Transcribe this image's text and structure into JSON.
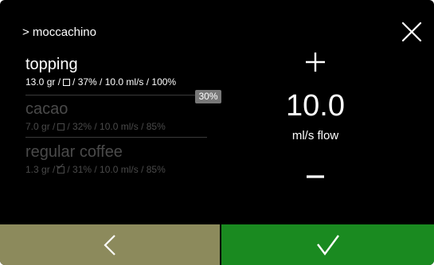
{
  "header": {
    "breadcrumb": "> moccachino"
  },
  "icons": {
    "close": "close-icon",
    "plus": "plus-icon",
    "minus": "minus-icon",
    "back": "chevron-left-icon",
    "confirm": "checkmark-icon"
  },
  "ingredients": [
    {
      "name": "topping",
      "amount": "13.0 gr /",
      "checkbox": false,
      "rest": "/ 37% / 10.0 ml/s / 100%",
      "state": "selected"
    },
    {
      "name": "cacao",
      "amount": "7.0 gr /",
      "checkbox": false,
      "rest": "/ 32% / 10.0 ml/s / 85%",
      "state": "inactive"
    },
    {
      "name": "regular coffee",
      "amount": "1.3 gr /",
      "checkbox": true,
      "rest": "/ 31% / 10.0 ml/s / 85%",
      "state": "inactive"
    }
  ],
  "badge": {
    "percent": "30%"
  },
  "control": {
    "value": "10.0",
    "unit": "ml/s flow"
  },
  "colors": {
    "background": "#000000",
    "text_active": "#ffffff",
    "text_inactive": "#4a4a4a",
    "back_button": "#8c8a5c",
    "confirm_button": "#1a8a20",
    "badge": "#777777"
  }
}
